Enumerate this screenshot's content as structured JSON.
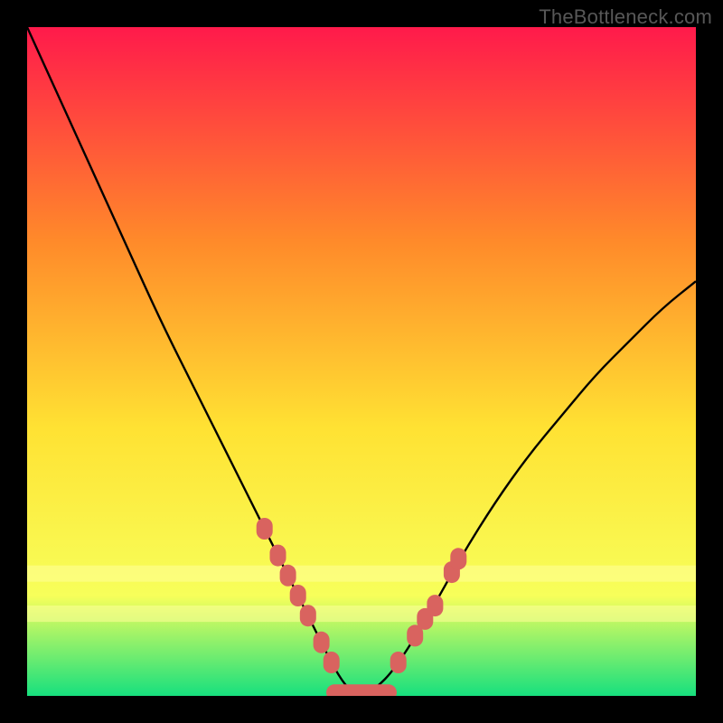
{
  "watermark": "TheBottleneck.com",
  "chart_data": {
    "type": "line",
    "title": "",
    "xlabel": "",
    "ylabel": "",
    "xlim": [
      0,
      100
    ],
    "ylim": [
      0,
      100
    ],
    "background_gradient": {
      "top": "#ff1a4b",
      "mid_upper": "#ff8a2a",
      "mid": "#ffe233",
      "mid_lower": "#f7ff5a",
      "bottom": "#17e07e"
    },
    "series": [
      {
        "name": "bottleneck-curve",
        "color": "#000000",
        "x": [
          0,
          5,
          10,
          15,
          20,
          25,
          30,
          35,
          38,
          40,
          42,
          44,
          46,
          48,
          50,
          52,
          55,
          60,
          65,
          70,
          75,
          80,
          85,
          90,
          95,
          100
        ],
        "y": [
          100,
          89,
          78,
          67,
          56,
          46,
          36,
          26,
          20,
          16,
          12,
          8,
          4,
          1,
          0,
          1,
          4,
          12,
          21,
          29,
          36,
          42,
          48,
          53,
          58,
          62
        ]
      }
    ],
    "markers": [
      {
        "name": "highlighted-points-left",
        "color": "#d9635f",
        "shape": "rounded-rect",
        "points": [
          {
            "x": 35.5,
            "y": 25
          },
          {
            "x": 37.5,
            "y": 21
          },
          {
            "x": 39,
            "y": 18
          },
          {
            "x": 40.5,
            "y": 15
          },
          {
            "x": 42,
            "y": 12
          },
          {
            "x": 44,
            "y": 8
          },
          {
            "x": 45.5,
            "y": 5
          }
        ]
      },
      {
        "name": "highlighted-points-bottom",
        "color": "#d9635f",
        "shape": "capsule",
        "points": [
          {
            "x": 50,
            "y": 0.5
          }
        ]
      },
      {
        "name": "highlighted-points-right",
        "color": "#d9635f",
        "shape": "rounded-rect",
        "points": [
          {
            "x": 55.5,
            "y": 5
          },
          {
            "x": 58,
            "y": 9
          },
          {
            "x": 59.5,
            "y": 11.5
          },
          {
            "x": 61,
            "y": 13.5
          },
          {
            "x": 63.5,
            "y": 18.5
          },
          {
            "x": 64.5,
            "y": 20.5
          }
        ]
      }
    ]
  }
}
